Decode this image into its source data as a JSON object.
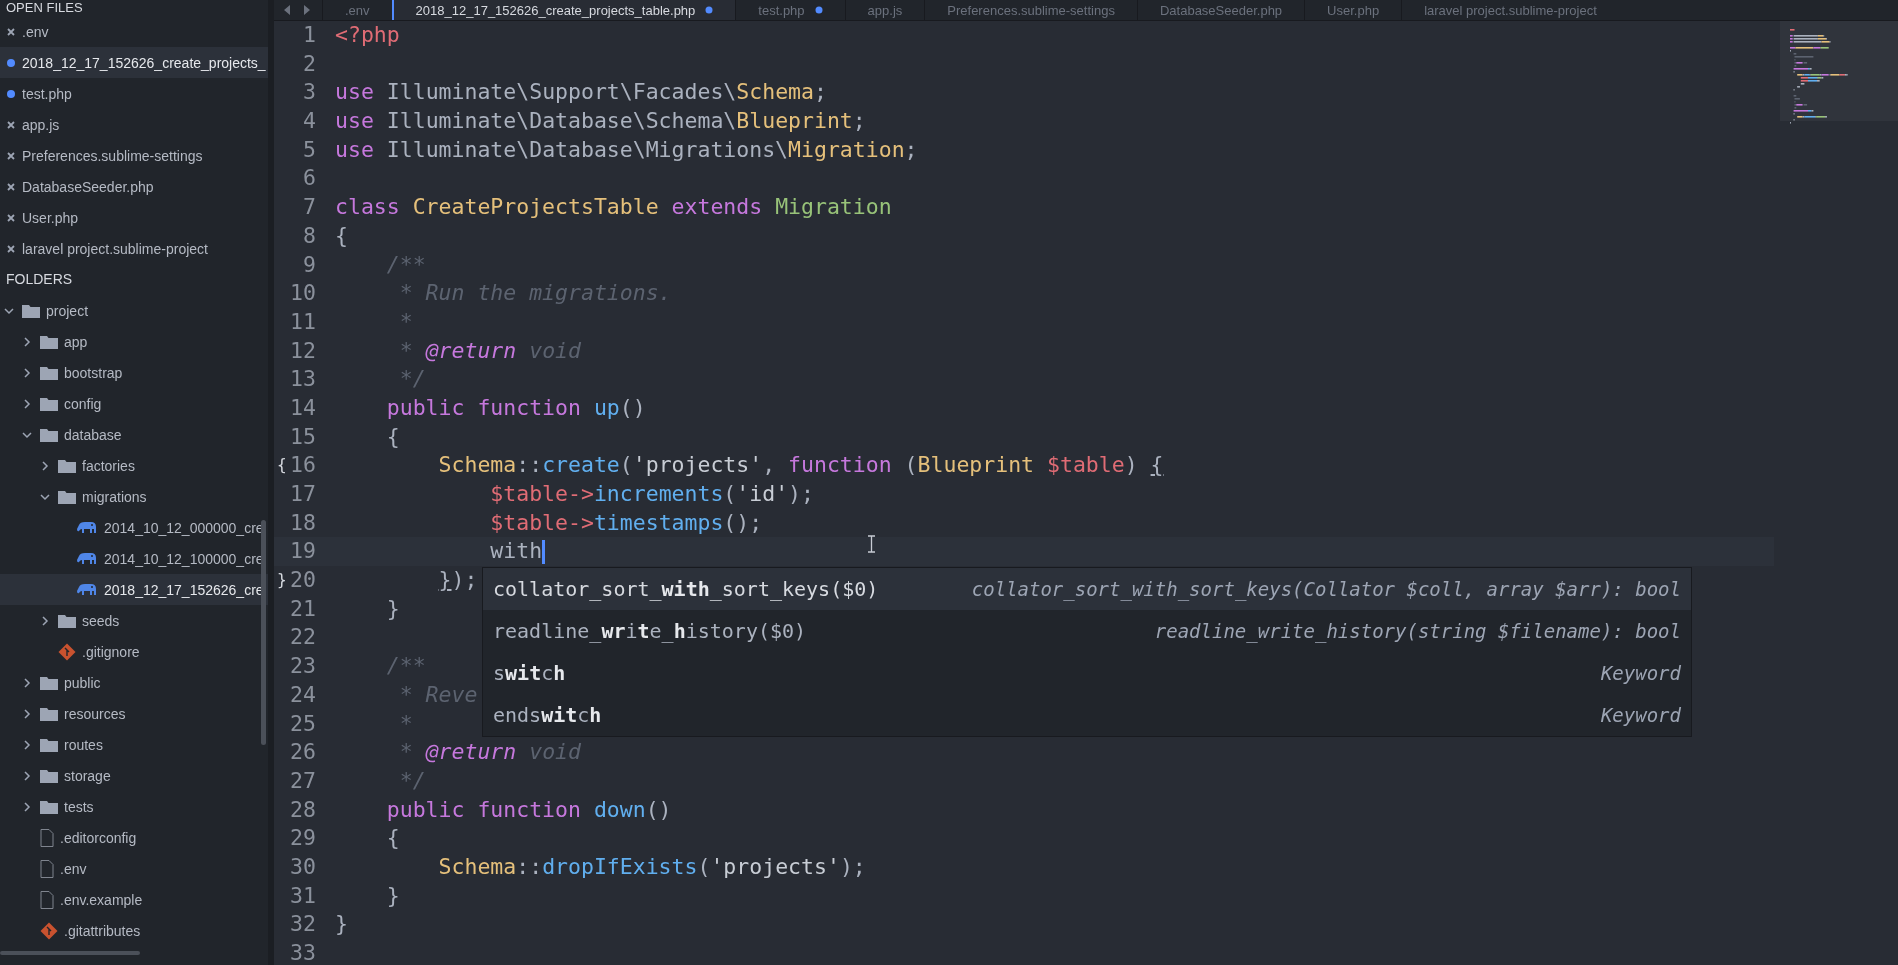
{
  "sidebar": {
    "open_files_header": "OPEN FILES",
    "open_files": [
      {
        "name": ".env",
        "modified": false,
        "selected": false
      },
      {
        "name": "2018_12_17_152626_create_projects_",
        "modified": true,
        "selected": true
      },
      {
        "name": "test.php",
        "modified": true,
        "selected": false
      },
      {
        "name": "app.js",
        "modified": false,
        "selected": false
      },
      {
        "name": "Preferences.sublime-settings",
        "modified": false,
        "selected": false
      },
      {
        "name": "DatabaseSeeder.php",
        "modified": false,
        "selected": false
      },
      {
        "name": "User.php",
        "modified": false,
        "selected": false
      },
      {
        "name": "laravel project.sublime-project",
        "modified": false,
        "selected": false
      }
    ],
    "folders_header": "FOLDERS",
    "tree": [
      {
        "name": "project",
        "kind": "folder",
        "expanded": true,
        "selected": false,
        "children": [
          {
            "name": "app",
            "kind": "folder",
            "expanded": false,
            "selected": false
          },
          {
            "name": "bootstrap",
            "kind": "folder",
            "expanded": false,
            "selected": false
          },
          {
            "name": "config",
            "kind": "folder",
            "expanded": false,
            "selected": false
          },
          {
            "name": "database",
            "kind": "folder",
            "expanded": true,
            "selected": false,
            "children": [
              {
                "name": "factories",
                "kind": "folder",
                "expanded": false,
                "selected": false
              },
              {
                "name": "migrations",
                "kind": "folder",
                "expanded": true,
                "selected": false,
                "children": [
                  {
                    "name": "2014_10_12_000000_cre",
                    "kind": "php",
                    "selected": false
                  },
                  {
                    "name": "2014_10_12_100000_cre",
                    "kind": "php",
                    "selected": false
                  },
                  {
                    "name": "2018_12_17_152626_cre",
                    "kind": "php",
                    "selected": true
                  }
                ]
              },
              {
                "name": "seeds",
                "kind": "folder",
                "expanded": false,
                "selected": false
              },
              {
                "name": ".gitignore",
                "kind": "git",
                "selected": false
              }
            ]
          },
          {
            "name": "public",
            "kind": "folder",
            "expanded": false,
            "selected": false
          },
          {
            "name": "resources",
            "kind": "folder",
            "expanded": false,
            "selected": false
          },
          {
            "name": "routes",
            "kind": "folder",
            "expanded": false,
            "selected": false
          },
          {
            "name": "storage",
            "kind": "folder",
            "expanded": false,
            "selected": false
          },
          {
            "name": "tests",
            "kind": "folder",
            "expanded": false,
            "selected": false
          },
          {
            "name": ".editorconfig",
            "kind": "file",
            "selected": false
          },
          {
            "name": ".env",
            "kind": "file",
            "selected": false
          },
          {
            "name": ".env.example",
            "kind": "file",
            "selected": false
          },
          {
            "name": ".gitattributes",
            "kind": "git",
            "selected": false
          }
        ]
      }
    ]
  },
  "tabs": [
    {
      "label": ".env",
      "modified": false,
      "selected": false
    },
    {
      "label": "2018_12_17_152626_create_projects_table.php",
      "modified": true,
      "selected": true
    },
    {
      "label": "test.php",
      "modified": true,
      "selected": false
    },
    {
      "label": "app.js",
      "modified": false,
      "selected": false
    },
    {
      "label": "Preferences.sublime-settings",
      "modified": false,
      "selected": false
    },
    {
      "label": "DatabaseSeeder.php",
      "modified": false,
      "selected": false
    },
    {
      "label": "User.php",
      "modified": false,
      "selected": false
    },
    {
      "label": "laravel project.sublime-project",
      "modified": false,
      "selected": false
    }
  ],
  "editor": {
    "lines": [
      {
        "number": "1",
        "tokens": [
          {
            "kind": "tag",
            "text": "<?php"
          }
        ]
      },
      {
        "number": "2"
      },
      {
        "number": "3",
        "tokens": [
          {
            "kind": "keyword",
            "text": "use"
          },
          {
            "kind": "plain",
            "text": " Illuminate\\Support\\Facades\\"
          },
          {
            "kind": "class",
            "text": "Schema"
          },
          {
            "kind": "plain",
            "text": ";"
          }
        ]
      },
      {
        "number": "4",
        "tokens": [
          {
            "kind": "keyword",
            "text": "use"
          },
          {
            "kind": "plain",
            "text": " Illuminate\\Database\\Schema\\"
          },
          {
            "kind": "class",
            "text": "Blueprint"
          },
          {
            "kind": "plain",
            "text": ";"
          }
        ]
      },
      {
        "number": "5",
        "tokens": [
          {
            "kind": "keyword",
            "text": "use"
          },
          {
            "kind": "plain",
            "text": " Illuminate\\Database\\Migrations\\"
          },
          {
            "kind": "class",
            "text": "Migration"
          },
          {
            "kind": "plain",
            "text": ";"
          }
        ]
      },
      {
        "number": "6"
      },
      {
        "number": "7",
        "tokens": [
          {
            "kind": "keyword",
            "text": "class "
          },
          {
            "kind": "class",
            "text": "CreateProjectsTable "
          },
          {
            "kind": "keyword",
            "text": "extends "
          },
          {
            "kind": "parent",
            "text": "Migration"
          }
        ]
      },
      {
        "number": "8",
        "tokens": [
          {
            "kind": "plain",
            "text": "{"
          }
        ]
      },
      {
        "number": "9",
        "tokens": [
          {
            "kind": "comment",
            "text": "    /**"
          }
        ]
      },
      {
        "number": "10",
        "tokens": [
          {
            "kind": "comment",
            "text": "     * Run the migrations."
          }
        ]
      },
      {
        "number": "11",
        "tokens": [
          {
            "kind": "comment",
            "text": "     *"
          }
        ]
      },
      {
        "number": "12",
        "tokens": [
          {
            "kind": "comment",
            "text": "     * "
          },
          {
            "kind": "doctag",
            "text": "@return"
          },
          {
            "kind": "comment",
            "text": " void"
          }
        ]
      },
      {
        "number": "13",
        "tokens": [
          {
            "kind": "comment",
            "text": "     */"
          }
        ]
      },
      {
        "number": "14",
        "tokens": [
          {
            "kind": "keyword",
            "text": "    public function "
          },
          {
            "kind": "func",
            "text": "up"
          },
          {
            "kind": "plain",
            "text": "()"
          }
        ]
      },
      {
        "number": "15",
        "tokens": [
          {
            "kind": "plain",
            "text": "    {"
          }
        ]
      },
      {
        "number": "16",
        "fold_marker": "{",
        "tokens": [
          {
            "kind": "class",
            "text": "        Schema"
          },
          {
            "kind": "plain",
            "text": "::"
          },
          {
            "kind": "func",
            "text": "create"
          },
          {
            "kind": "plain",
            "text": "("
          },
          {
            "kind": "string",
            "text": "'projects'"
          },
          {
            "kind": "plain",
            "text": ", "
          },
          {
            "kind": "keyword",
            "text": "function"
          },
          {
            "kind": "plain",
            "text": " ("
          },
          {
            "kind": "class",
            "text": "Blueprint "
          },
          {
            "kind": "var",
            "text": "$table"
          },
          {
            "kind": "plain",
            "text": ") "
          },
          {
            "kind": "matched",
            "text": "{"
          }
        ]
      },
      {
        "number": "17",
        "tokens": [
          {
            "kind": "var",
            "text": "            $table->"
          },
          {
            "kind": "func",
            "text": "increments"
          },
          {
            "kind": "plain",
            "text": "("
          },
          {
            "kind": "string",
            "text": "'id'"
          },
          {
            "kind": "plain",
            "text": ");"
          }
        ]
      },
      {
        "number": "18",
        "tokens": [
          {
            "kind": "var",
            "text": "            $table->"
          },
          {
            "kind": "func",
            "text": "timestamps"
          },
          {
            "kind": "plain",
            "text": "();"
          }
        ]
      },
      {
        "number": "19",
        "current": true,
        "cursor": true,
        "tokens": [
          {
            "kind": "plain",
            "text": "            with"
          }
        ]
      },
      {
        "number": "20",
        "fold_marker": "}",
        "tokens": [
          {
            "kind": "matched",
            "text": "        }"
          },
          {
            "kind": "plain",
            "text": ");"
          }
        ]
      },
      {
        "number": "21",
        "tokens": [
          {
            "kind": "plain",
            "text": "    }"
          }
        ]
      },
      {
        "number": "22"
      },
      {
        "number": "23",
        "tokens": [
          {
            "kind": "comment",
            "text": "    /**"
          }
        ]
      },
      {
        "number": "24",
        "tokens": [
          {
            "kind": "comment",
            "text": "     * Reve"
          }
        ]
      },
      {
        "number": "25",
        "tokens": [
          {
            "kind": "comment",
            "text": "     *"
          }
        ]
      },
      {
        "number": "26",
        "tokens": [
          {
            "kind": "comment",
            "text": "     * "
          },
          {
            "kind": "doctag",
            "text": "@return"
          },
          {
            "kind": "comment",
            "text": " void"
          }
        ]
      },
      {
        "number": "27",
        "tokens": [
          {
            "kind": "comment",
            "text": "     */"
          }
        ]
      },
      {
        "number": "28",
        "tokens": [
          {
            "kind": "keyword",
            "text": "    public function "
          },
          {
            "kind": "func",
            "text": "down"
          },
          {
            "kind": "plain",
            "text": "()"
          }
        ]
      },
      {
        "number": "29",
        "tokens": [
          {
            "kind": "plain",
            "text": "    {"
          }
        ]
      },
      {
        "number": "30",
        "tokens": [
          {
            "kind": "class",
            "text": "        Schema"
          },
          {
            "kind": "plain",
            "text": "::"
          },
          {
            "kind": "func",
            "text": "dropIfExists"
          },
          {
            "kind": "plain",
            "text": "("
          },
          {
            "kind": "string",
            "text": "'projects'"
          },
          {
            "kind": "plain",
            "text": ");"
          }
        ]
      },
      {
        "number": "31",
        "tokens": [
          {
            "kind": "plain",
            "text": "    }"
          }
        ]
      },
      {
        "number": "32",
        "tokens": [
          {
            "kind": "plain",
            "text": "}"
          }
        ]
      },
      {
        "number": "33"
      }
    ]
  },
  "autocomplete": [
    {
      "label": "collator_sort_**with**_sort_keys($0)",
      "detail": "collator_sort_with_sort_keys(Collator $coll, array $arr): bool",
      "selected": true
    },
    {
      "label": "readline_**wr**i**t**e_**h**istory($0)",
      "detail": "readline_write_history(string $filename): bool",
      "selected": false
    },
    {
      "label": "s**wit**c**h**",
      "detail": "Keyword",
      "selected": false
    },
    {
      "label": "ends**wit**c**h**",
      "detail": "Keyword",
      "selected": false
    }
  ]
}
